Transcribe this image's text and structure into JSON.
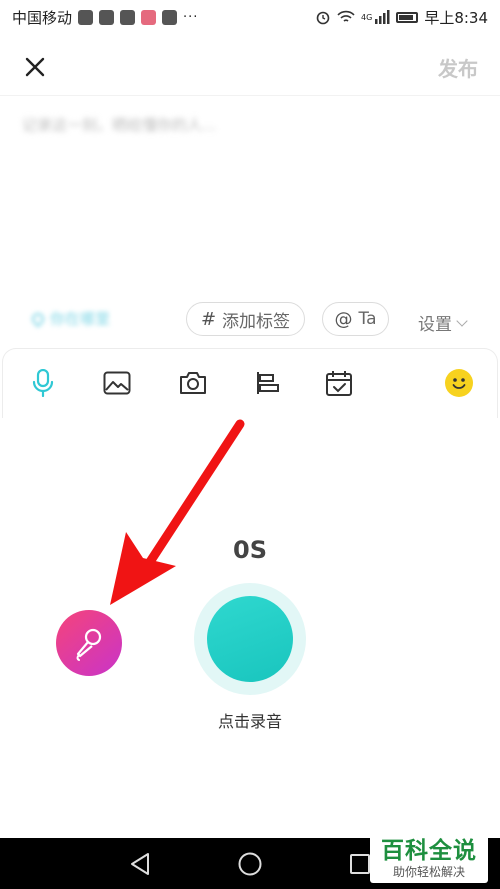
{
  "status_bar": {
    "carrier": "中国移动",
    "more": "···",
    "network": "4G",
    "time": "早上8:34"
  },
  "header": {
    "close_icon": "close-icon",
    "publish_label": "发布"
  },
  "editor": {
    "placeholder": "记录这一刻，晒给懂你的人..."
  },
  "tags_row": {
    "location_text": "你在哪里",
    "add_tag_glyph": "#",
    "add_tag_label": "添加标签",
    "mention_glyph": "@",
    "mention_label": "Ta",
    "settings_label": "设置"
  },
  "toolbar": {
    "items": [
      {
        "name": "microphone-icon",
        "active": true
      },
      {
        "name": "image-icon",
        "active": false
      },
      {
        "name": "camera-icon",
        "active": false
      },
      {
        "name": "align-icon",
        "active": false
      },
      {
        "name": "calendar-check-icon",
        "active": false
      },
      {
        "name": "emoji-icon",
        "active": false
      }
    ],
    "accent_color": "#2fc8d4"
  },
  "recorder": {
    "timer": "0S",
    "record_label": "点击录音",
    "record_color": "#22ccc5"
  },
  "watermark": {
    "title": "百科全说",
    "subtitle": "助你轻松解决"
  }
}
